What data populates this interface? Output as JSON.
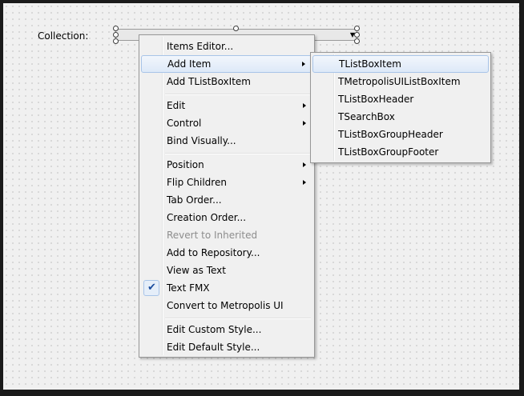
{
  "form": {
    "collection_label": "Collection:"
  },
  "context_menu": {
    "items": [
      {
        "label": "Items Editor..."
      },
      {
        "label": "Add Item",
        "submenu": true,
        "highlighted": true
      },
      {
        "label": "Add TListBoxItem"
      },
      {
        "label": "Edit",
        "submenu": true
      },
      {
        "label": "Control",
        "submenu": true
      },
      {
        "label": "Bind Visually..."
      },
      {
        "label": "Position",
        "submenu": true
      },
      {
        "label": "Flip Children",
        "submenu": true
      },
      {
        "label": "Tab Order..."
      },
      {
        "label": "Creation Order..."
      },
      {
        "label": "Revert to Inherited",
        "disabled": true
      },
      {
        "label": "Add to Repository..."
      },
      {
        "label": "View as Text"
      },
      {
        "label": "Text FMX",
        "checked": true
      },
      {
        "label": "Convert to Metropolis UI"
      },
      {
        "label": "Edit Custom Style..."
      },
      {
        "label": "Edit Default Style..."
      }
    ]
  },
  "submenu": {
    "items": [
      {
        "label": "TListBoxItem",
        "highlighted": true
      },
      {
        "label": "TMetropolisUIListBoxItem"
      },
      {
        "label": "TListBoxHeader"
      },
      {
        "label": "TSearchBox"
      },
      {
        "label": "TListBoxGroupHeader"
      },
      {
        "label": "TListBoxGroupFooter"
      }
    ]
  },
  "colors": {
    "highlight_border": "#a8c4e8",
    "check_mark": "#1a4c9e",
    "disabled_text": "#8d8d8d"
  }
}
